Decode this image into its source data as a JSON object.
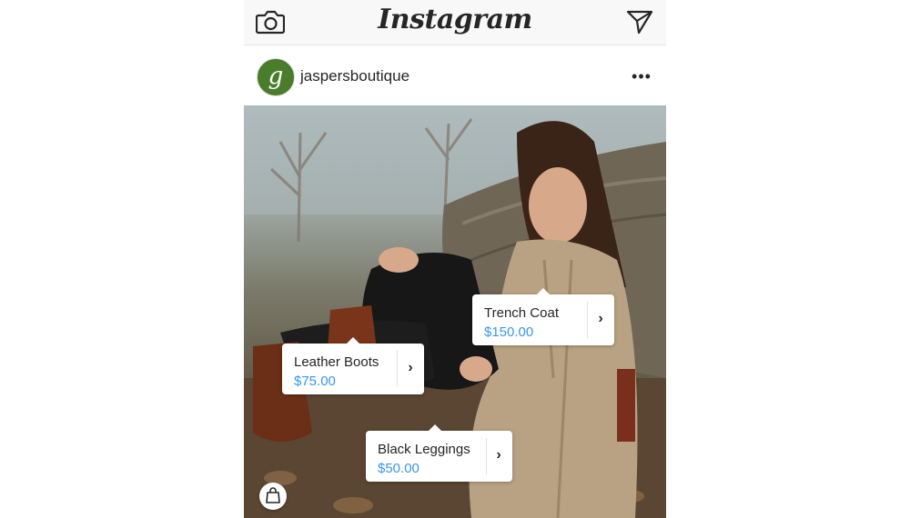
{
  "app": {
    "logo_text": "Instagram"
  },
  "topbar": {
    "camera_icon": "camera-icon",
    "direct_icon": "paper-plane-icon"
  },
  "post": {
    "username": "jaspersboutique",
    "avatar_letter": "g",
    "more_label": "•••",
    "product_tags": [
      {
        "name": "Trench Coat",
        "price": "$150.00"
      },
      {
        "name": "Leather Boots",
        "price": "$75.00"
      },
      {
        "name": "Black Leggings",
        "price": "$50.00"
      }
    ],
    "chevron": "›",
    "shopping_bag_icon": "shopping-bag-icon"
  },
  "colors": {
    "price": "#3897f0",
    "avatar": "#4a7d2b",
    "text": "#262626"
  }
}
